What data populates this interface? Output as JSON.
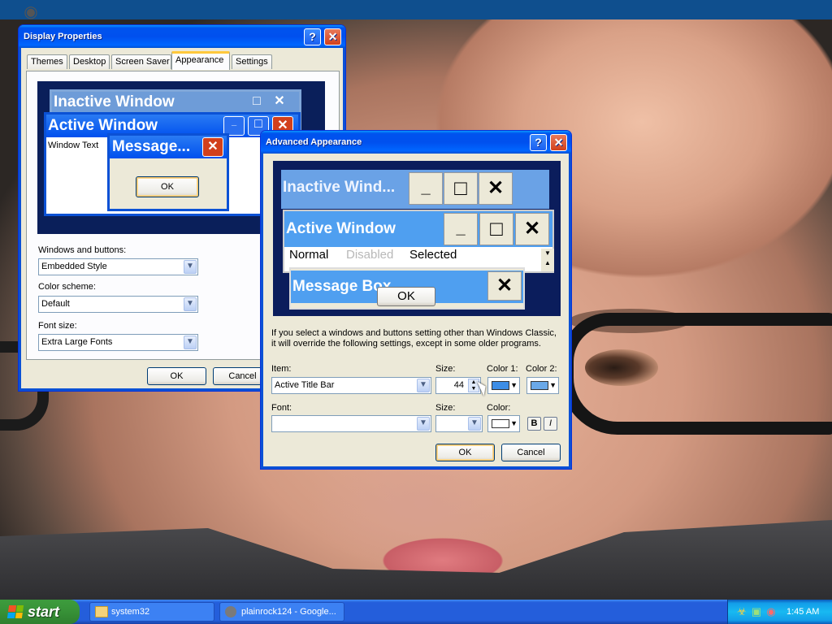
{
  "desktop": {
    "wallpaper": "photo-of-person-with-glasses"
  },
  "display_properties": {
    "title": "Display Properties",
    "tabs": [
      "Themes",
      "Desktop",
      "Screen Saver",
      "Appearance",
      "Settings"
    ],
    "active_tab": "Appearance",
    "preview": {
      "inactive_title": "Inactive Window",
      "active_title": "Active Window",
      "window_text": "Window Text",
      "message_title": "Message...",
      "message_ok": "OK"
    },
    "windows_and_buttons_label": "Windows and buttons:",
    "windows_and_buttons_value": "Embedded Style",
    "color_scheme_label": "Color scheme:",
    "color_scheme_value": "Default",
    "font_size_label": "Font size:",
    "font_size_value": "Extra Large Fonts",
    "ok": "OK",
    "cancel": "Cancel"
  },
  "advanced_appearance": {
    "title": "Advanced Appearance",
    "preview": {
      "inactive_title": "Inactive Wind...",
      "active_title": "Active Window",
      "menu_normal": "Normal",
      "menu_disabled": "Disabled",
      "menu_selected": "Selected",
      "message_title": "Message Box",
      "message_ok": "OK"
    },
    "info_text": "If you select a windows and buttons setting other than Windows Classic, it will override the following settings, except in some older programs.",
    "item_label": "Item:",
    "item_value": "Active Title Bar",
    "size_label": "Size:",
    "size_value": "44",
    "color1_label": "Color 1:",
    "color2_label": "Color 2:",
    "font_label": "Font:",
    "font_value": "",
    "font_size_label": "Size:",
    "font_size_value": "",
    "font_color_label": "Color:",
    "bold_label": "B",
    "italic_label": "I",
    "ok": "OK",
    "cancel": "Cancel",
    "colors": {
      "color1": "#3c8de6",
      "color2": "#6aa8e8",
      "font_color": "#ffffff"
    }
  },
  "taskbar": {
    "start_label": "start",
    "tasks": [
      {
        "label": "system32",
        "icon": "folder-icon"
      },
      {
        "label": "plainrock124 - Google...",
        "icon": "raccoon-icon"
      }
    ],
    "clock": "1:45 AM",
    "tray_icons": [
      "shield-icon",
      "network-icon",
      "security-icon"
    ]
  },
  "theme_colors": {
    "titlebar": "#0054e3",
    "window_bg": "#ece9d8",
    "close_red": "#d2401c",
    "preview_bg": "#0a1f5a",
    "preview_active": "#4f9ff0",
    "preview_inactive": "#7fb3ee"
  }
}
